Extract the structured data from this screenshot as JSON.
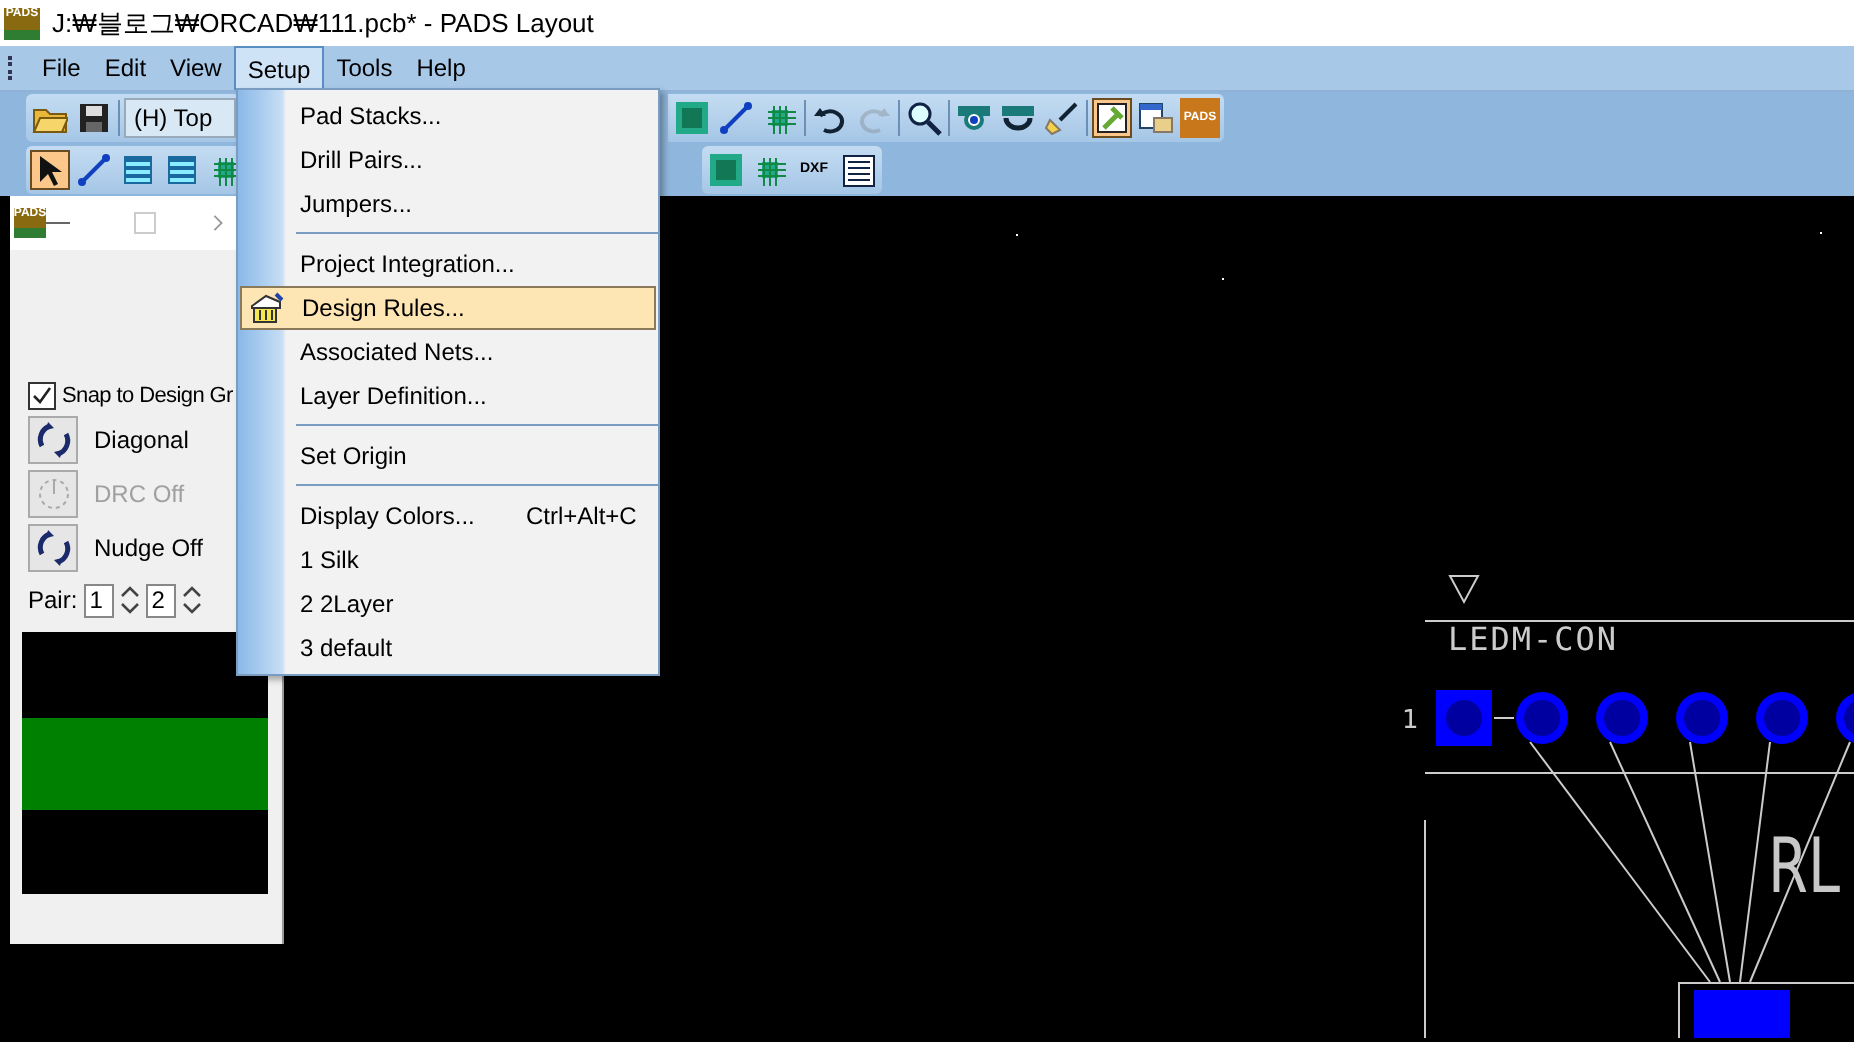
{
  "window": {
    "title": "J:₩블로그₩ORCAD₩111.pcb* - PADS Layout",
    "icon_text": "PADS"
  },
  "menubar": [
    {
      "label": "File",
      "selected": false
    },
    {
      "label": "Edit",
      "selected": false
    },
    {
      "label": "View",
      "selected": false
    },
    {
      "label": "Setup",
      "selected": true
    },
    {
      "label": "Tools",
      "selected": false
    },
    {
      "label": "Help",
      "selected": false
    }
  ],
  "toolbar_top": {
    "left": [
      {
        "kind": "open",
        "selected": false
      },
      {
        "kind": "save",
        "selected": false
      }
    ],
    "layer": "(H) Top",
    "right": [
      {
        "kind": "partial",
        "selected": false
      },
      {
        "kind": "route",
        "selected": false
      },
      {
        "kind": "chip",
        "selected": false
      },
      {
        "kind": "sep"
      },
      {
        "kind": "undo",
        "selected": false,
        "disabled": false
      },
      {
        "kind": "redo",
        "selected": false,
        "disabled": true
      },
      {
        "kind": "sep"
      },
      {
        "kind": "zoom",
        "selected": false
      },
      {
        "kind": "sep"
      },
      {
        "kind": "view",
        "selected": false
      },
      {
        "kind": "redraw",
        "selected": false
      },
      {
        "kind": "brush",
        "selected": false
      },
      {
        "kind": "sep"
      },
      {
        "kind": "hammer",
        "selected": true
      },
      {
        "kind": "window",
        "selected": false
      },
      {
        "kind": "logo",
        "selected": false,
        "label": "PADS"
      }
    ]
  },
  "toolbar_bottom": {
    "left": [
      {
        "kind": "select",
        "selected": true
      },
      {
        "kind": "route",
        "selected": false
      },
      {
        "kind": "layers",
        "selected": false
      },
      {
        "kind": "layers",
        "selected": false
      },
      {
        "kind": "chip",
        "selected": false
      }
    ],
    "right": [
      {
        "kind": "partial",
        "selected": false
      },
      {
        "kind": "chip",
        "selected": false
      },
      {
        "kind": "dxf",
        "selected": false,
        "label": "DXF"
      },
      {
        "kind": "list",
        "selected": false
      }
    ]
  },
  "menu": [
    {
      "kind": "item",
      "label": "Pad Stacks...",
      "selected": false
    },
    {
      "kind": "item",
      "label": "Drill Pairs...",
      "selected": false
    },
    {
      "kind": "item",
      "label": "Jumpers...",
      "selected": false
    },
    {
      "kind": "separator"
    },
    {
      "kind": "item",
      "label": "Project Integration...",
      "selected": false
    },
    {
      "kind": "item",
      "label": "Design Rules...",
      "selected": true,
      "icon": true
    },
    {
      "kind": "item",
      "label": "Associated Nets...",
      "selected": false
    },
    {
      "kind": "item",
      "label": "Layer Definition...",
      "selected": false
    },
    {
      "kind": "separator"
    },
    {
      "kind": "item",
      "label": "Set Origin",
      "selected": false
    },
    {
      "kind": "separator"
    },
    {
      "kind": "item",
      "label": "Display Colors...",
      "shortcut": "Ctrl+Alt+C",
      "selected": false
    },
    {
      "kind": "item",
      "label": "1 Silk",
      "selected": false
    },
    {
      "kind": "item",
      "label": "2 2Layer",
      "selected": false
    },
    {
      "kind": "item",
      "label": "3 default",
      "selected": false
    }
  ],
  "panel": {
    "icon_text": "PADS",
    "snap": {
      "label": "Snap to Design Gr",
      "checked": true
    },
    "buttons": [
      {
        "label": "Diagonal",
        "disabled": false
      },
      {
        "label": "DRC Off",
        "disabled": true
      },
      {
        "label": "Nudge Off",
        "disabled": false
      }
    ],
    "pair": {
      "label": "Pair:",
      "first": "1",
      "second": "2"
    }
  },
  "canvas": {
    "part_name": "LEDM-CON",
    "pin_label": "1",
    "ref_text": "RL"
  }
}
